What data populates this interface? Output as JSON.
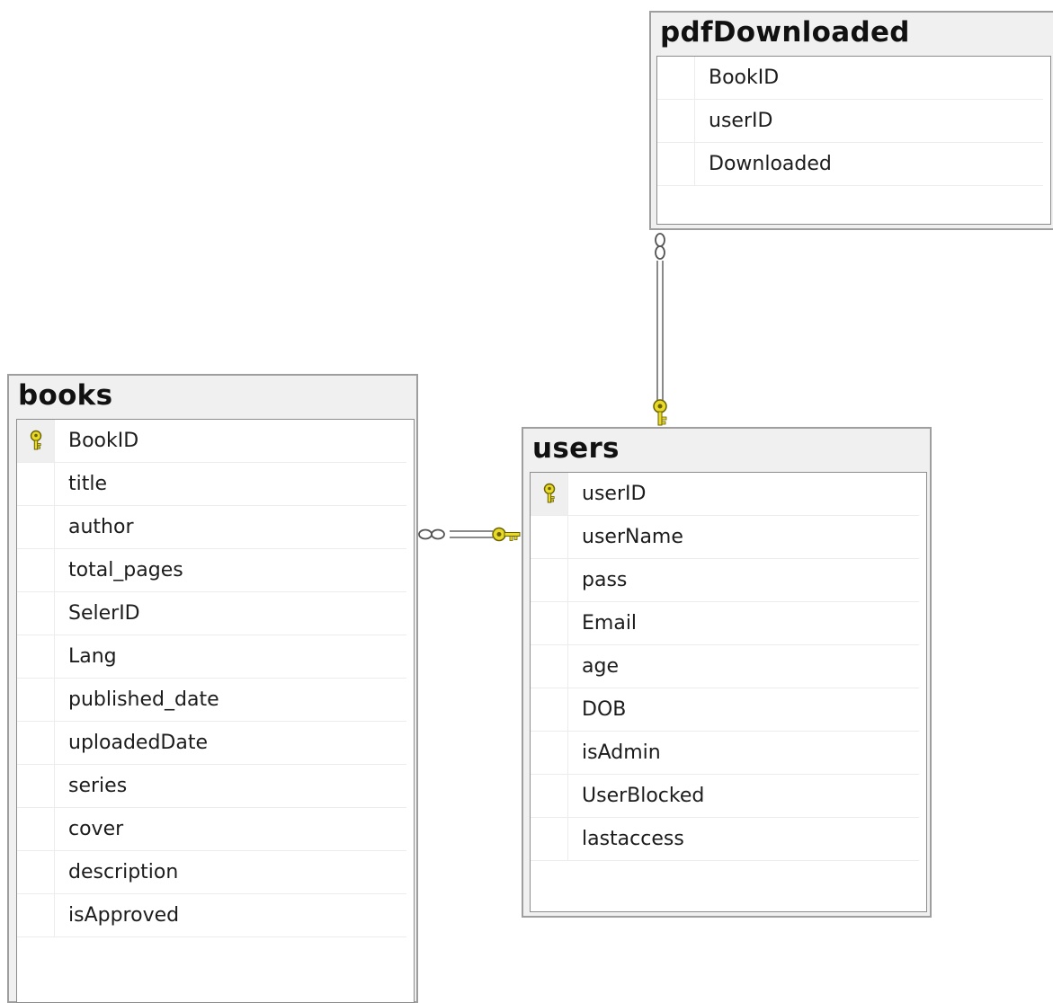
{
  "tables": {
    "pdfDownloaded": {
      "name": "pdfDownloaded",
      "columns": [
        {
          "name": "BookID",
          "primary_key": false
        },
        {
          "name": "userID",
          "primary_key": false
        },
        {
          "name": "Downloaded",
          "primary_key": false
        }
      ]
    },
    "books": {
      "name": "books",
      "columns": [
        {
          "name": "BookID",
          "primary_key": true
        },
        {
          "name": "title",
          "primary_key": false
        },
        {
          "name": "author",
          "primary_key": false
        },
        {
          "name": "total_pages",
          "primary_key": false
        },
        {
          "name": "SelerID",
          "primary_key": false
        },
        {
          "name": "Lang",
          "primary_key": false
        },
        {
          "name": "published_date",
          "primary_key": false
        },
        {
          "name": "uploadedDate",
          "primary_key": false
        },
        {
          "name": "series",
          "primary_key": false
        },
        {
          "name": "cover",
          "primary_key": false
        },
        {
          "name": "description",
          "primary_key": false
        },
        {
          "name": "isApproved",
          "primary_key": false
        }
      ]
    },
    "users": {
      "name": "users",
      "columns": [
        {
          "name": "userID",
          "primary_key": true
        },
        {
          "name": "userName",
          "primary_key": false
        },
        {
          "name": "pass",
          "primary_key": false
        },
        {
          "name": "Email",
          "primary_key": false
        },
        {
          "name": "age",
          "primary_key": false
        },
        {
          "name": "DOB",
          "primary_key": false
        },
        {
          "name": "isAdmin",
          "primary_key": false
        },
        {
          "name": "UserBlocked",
          "primary_key": false
        },
        {
          "name": "lastaccess",
          "primary_key": false
        }
      ]
    }
  },
  "relationships": [
    {
      "from": "pdfDownloaded",
      "from_end": "many-infinity",
      "to": "users",
      "to_end": "one-key"
    },
    {
      "from": "books",
      "from_end": "many-infinity",
      "to": "users",
      "to_end": "one-key"
    }
  ],
  "colors": {
    "key_yellow": "#e8d92a",
    "key_outline": "#6a6200",
    "relationship_line": "#8a8a8a",
    "table_border": "#9e9e9e",
    "table_header_bg": "#f0f0f0"
  },
  "icons": {
    "primary_key": "key-icon",
    "many_end": "infinity-icon",
    "one_end": "key-icon"
  }
}
